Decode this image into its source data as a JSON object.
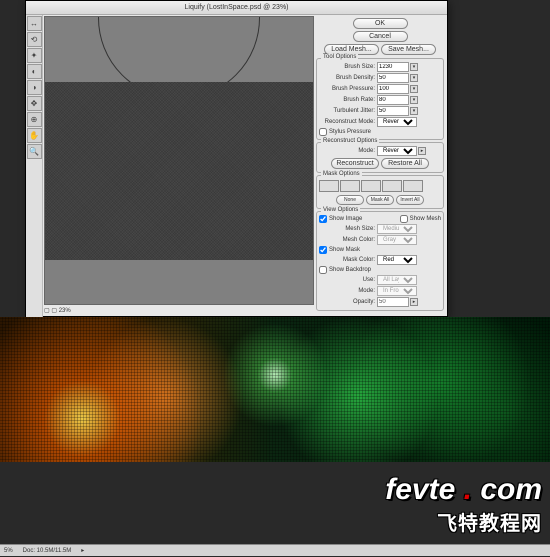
{
  "dialog": {
    "title": "Liquify (LostInSpace.psd @ 23%)",
    "zoom": "23%",
    "tools": [
      "↔",
      "⟲",
      "✦",
      "◐",
      "◑",
      "✥",
      "⊕",
      "✋",
      "🔍"
    ]
  },
  "buttons": {
    "ok": "OK",
    "cancel": "Cancel",
    "load_mesh": "Load Mesh...",
    "save_mesh": "Save Mesh...",
    "reconstruct": "Reconstruct",
    "restore_all": "Restore All",
    "none": "None",
    "mask_all": "Mask All",
    "invert_all": "Invert All"
  },
  "tool_options": {
    "title": "Tool Options",
    "brush_size": {
      "label": "Brush Size:",
      "value": "1230"
    },
    "brush_density": {
      "label": "Brush Density:",
      "value": "50"
    },
    "brush_pressure": {
      "label": "Brush Pressure:",
      "value": "100"
    },
    "brush_rate": {
      "label": "Brush Rate:",
      "value": "80"
    },
    "turbulent_jitter": {
      "label": "Turbulent Jitter:",
      "value": "50"
    },
    "reconstruct_mode": {
      "label": "Reconstruct Mode:",
      "value": "Revert"
    },
    "stylus_pressure": "Stylus Pressure"
  },
  "reconstruct_options": {
    "title": "Reconstruct Options",
    "mode": {
      "label": "Mode:",
      "value": "Revert"
    }
  },
  "mask_options": {
    "title": "Mask Options"
  },
  "view_options": {
    "title": "View Options",
    "show_image": "Show Image",
    "show_mesh": "Show Mesh",
    "mesh_size": {
      "label": "Mesh Size:",
      "value": "Medium"
    },
    "mesh_color": {
      "label": "Mesh Color:",
      "value": "Gray"
    },
    "show_mask": "Show Mask",
    "mask_color": {
      "label": "Mask Color:",
      "value": "Red"
    },
    "show_backdrop": "Show Backdrop",
    "use": {
      "label": "Use:",
      "value": "All Layers"
    },
    "mode": {
      "label": "Mode:",
      "value": "In Front"
    },
    "opacity": {
      "label": "Opacity:",
      "value": "50"
    }
  },
  "watermark": {
    "line1a": "fevte",
    "line1b": "com",
    "line2": "飞特教程网"
  },
  "ps_status": {
    "pct": "5%",
    "doc": "Doc: 10.5M/11.5M"
  }
}
